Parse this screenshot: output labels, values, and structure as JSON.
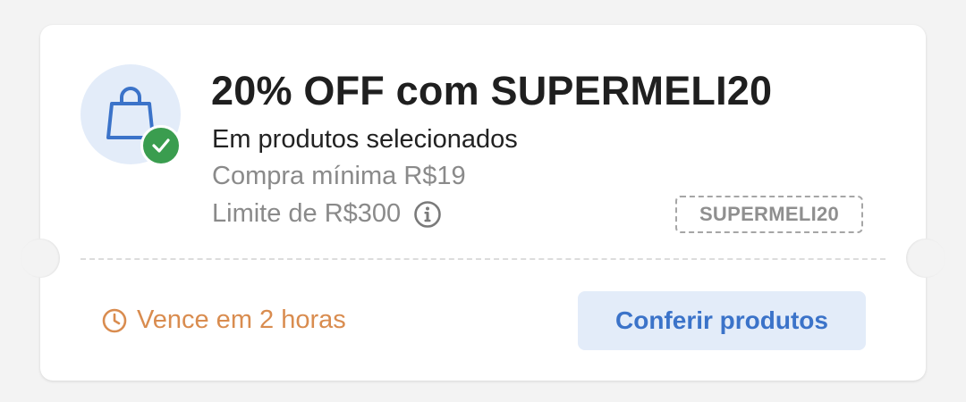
{
  "coupon": {
    "title": "20% OFF com SUPERMELI20",
    "subtitle": "Em produtos selecionados",
    "min_purchase": "Compra mínima R$19",
    "limit": "Limite de R$300",
    "code": "SUPERMELI20",
    "expiry": "Vence em 2 horas",
    "cta_label": "Conferir produtos",
    "icons": {
      "main": "shopping-bag-icon",
      "badge": "check-icon",
      "info": "info-icon",
      "expiry": "clock-icon"
    },
    "colors": {
      "accent": "#3b73c9",
      "accent_bg": "#e3ecf9",
      "success": "#3a9d4f",
      "warning": "#d98c4f",
      "text_primary": "#1f1f1f",
      "text_secondary": "#8a8a8a"
    }
  }
}
